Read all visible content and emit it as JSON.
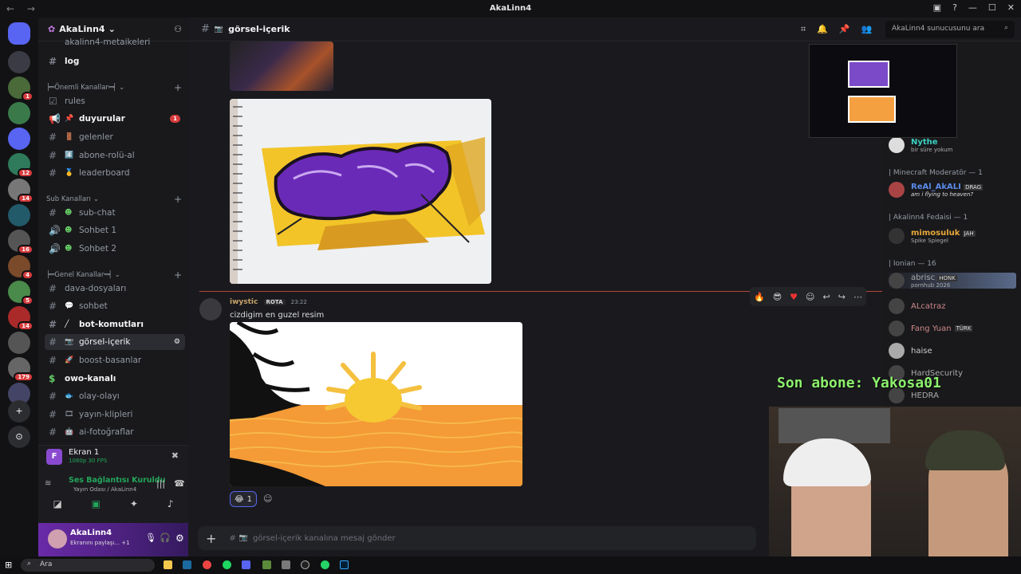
{
  "window": {
    "title": "AkaLinn4",
    "nav": "← →"
  },
  "servers": [
    {
      "color": "#3b3b45",
      "badge": ""
    },
    {
      "color": "#4a6a3a",
      "badge": "1"
    },
    {
      "color": "#3a7a4a",
      "badge": ""
    },
    {
      "color": "#5865f2",
      "badge": ""
    },
    {
      "color": "#2e7a5a",
      "badge": "12"
    },
    {
      "color": "#777",
      "badge": "14"
    },
    {
      "color": "#225a6a",
      "badge": ""
    },
    {
      "color": "#555",
      "badge": "16"
    },
    {
      "color": "#7a4a2a",
      "badge": "4"
    },
    {
      "color": "#4a8a4a",
      "badge": "5"
    },
    {
      "color": "#aa2a2a",
      "badge": "14"
    },
    {
      "color": "#555",
      "badge": ""
    },
    {
      "color": "#666",
      "badge": "179"
    },
    {
      "color": "#446",
      "badge": ""
    }
  ],
  "guild": {
    "name": "AkaLinn4"
  },
  "channels": {
    "top_cut": "akalinn4-metaikeleri",
    "log": "log",
    "cat1": "╞═Önemli Kanallar═╡",
    "rules": "rules",
    "duyurular": "duyurular",
    "duyurular_badge": "1",
    "gelenler": "gelenler",
    "abone": "abone-rolü-al",
    "leaderboard": "leaderboard",
    "cat2": "Sub Kanalları",
    "subchat": "sub-chat",
    "sohbet1": "Sohbet 1",
    "sohbet2": "Sohbet 2",
    "cat3": "╞═Genel Kanallar═╡",
    "dava": "dava-dosyaları",
    "sohbet": "sohbet",
    "bot": "bot-komutları",
    "gorsel": "görsel-içerik",
    "boost": "boost-basanlar",
    "owo": "owo-kanalı",
    "olay": "olay-olayı",
    "yayin": "yayın-klipleri",
    "ai": "ai-fotoğraflar"
  },
  "stream": {
    "title": "Ekran 1",
    "sub": "1080p 30 FPS"
  },
  "voice": {
    "status": "Ses Bağlantısı Kuruldu",
    "room": "Yayın Odası / AkaLinn4"
  },
  "user": {
    "name": "AkaLinn4",
    "status": "Ekranını paylaşı... +1"
  },
  "header": {
    "channel": "görsel-içerik",
    "search_placeholder": "AkaLinn4 sunucusunu ara"
  },
  "message": {
    "author": "iwystic",
    "role": "ROTA",
    "time": "23:22",
    "text": "cizdigim en guzel resim",
    "reaction_count": "1"
  },
  "composer": {
    "placeholder": "görsel-içerik kanalına mesaj gönder"
  },
  "members": {
    "m1": {
      "name": "Nythe",
      "status": "bir süre yokum"
    },
    "h1": "| Minecraft Moderatör — 1",
    "m2": {
      "name": "ReAl_AkALI",
      "tag": "DRAG",
      "status": "am i flying to heaven?"
    },
    "h2": "| Akalinn4 Fedaisi — 1",
    "m3": {
      "name": "mimosuluk",
      "tag": "JAH",
      "status": "Spike Spiegel"
    },
    "h3": "| Ionian — 16",
    "m4": {
      "name": "abrisc",
      "tag": "HONK",
      "status": "pornhub 2026"
    },
    "m5": {
      "name": "ALcatraz"
    },
    "m6": {
      "name": "Fang Yuan",
      "tag": "TÜRK"
    },
    "m7": {
      "name": "haise"
    },
    "m8": {
      "name": "HardSecurity"
    },
    "m9": {
      "name": "HEDRA"
    }
  },
  "overlay": {
    "sub_alert": "Son abone: Yakosa01"
  },
  "taskbar": {
    "search": "Ara"
  }
}
